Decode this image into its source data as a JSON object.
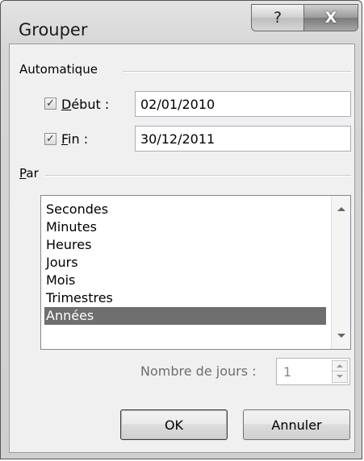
{
  "window": {
    "title": "Grouper",
    "help_glyph": "?",
    "close_glyph": "X"
  },
  "automatique": {
    "label": "Automatique",
    "start": {
      "label_mnemonic": "D",
      "label_rest": "ébut :",
      "checked": true,
      "check_glyph": "✓",
      "value": "02/01/2010"
    },
    "end": {
      "label_mnemonic": "F",
      "label_rest": "in :",
      "checked": true,
      "check_glyph": "✓",
      "value": "30/12/2011"
    }
  },
  "par": {
    "label_mnemonic": "P",
    "label_rest": "ar",
    "items": [
      "Secondes",
      "Minutes",
      "Heures",
      "Jours",
      "Mois",
      "Trimestres",
      "Années"
    ],
    "selected": "Années"
  },
  "days": {
    "label": "Nombre de jours :",
    "value": "1"
  },
  "buttons": {
    "ok": "OK",
    "cancel": "Annuler"
  },
  "colors": {
    "selection": "#6e6e6e",
    "dialog_bg": "#f0f0f0"
  }
}
